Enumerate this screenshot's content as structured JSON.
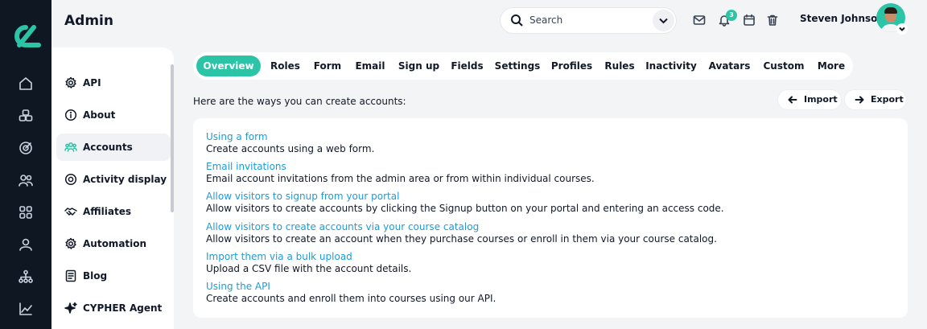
{
  "header": {
    "title": "Admin",
    "search_label": "Search",
    "notification_count": "3",
    "user_name": "Steven Johnson"
  },
  "colors": {
    "accent": "#2bc4a6",
    "link": "#1e9bd7",
    "rail": "#0f1722"
  },
  "rail_icons": [
    "home-icon",
    "modules-icon",
    "target-icon",
    "users-icon",
    "apps-grid-icon",
    "profile-icon",
    "org-chart-icon",
    "chart-icon"
  ],
  "sidebar": {
    "items": [
      {
        "label": "API",
        "icon": "gear-icon"
      },
      {
        "label": "About",
        "icon": "info-icon"
      },
      {
        "label": "Accounts",
        "icon": "people-icon"
      },
      {
        "label": "Activity display",
        "icon": "target-icon"
      },
      {
        "label": "Affiliates",
        "icon": "handshake-icon"
      },
      {
        "label": "Automation",
        "icon": "gear-icon"
      },
      {
        "label": "Blog",
        "icon": "document-icon"
      },
      {
        "label": "CYPHER Agent",
        "icon": "sparkle-icon"
      }
    ],
    "active": "Accounts"
  },
  "tabs": [
    {
      "label": "Overview"
    },
    {
      "label": "Roles"
    },
    {
      "label": "Form"
    },
    {
      "label": "Email"
    },
    {
      "label": "Sign up"
    },
    {
      "label": "Fields"
    },
    {
      "label": "Settings"
    },
    {
      "label": "Profiles"
    },
    {
      "label": "Rules"
    },
    {
      "label": "Inactivity"
    },
    {
      "label": "Avatars"
    },
    {
      "label": "Custom"
    },
    {
      "label": "More"
    }
  ],
  "main": {
    "intro": "Here are the ways you can create accounts:",
    "import_label": "Import",
    "export_label": "Export",
    "options": [
      {
        "title": "Using a form",
        "desc": "Create accounts using a web form."
      },
      {
        "title": "Email invitations",
        "desc": "Email account invitations from the admin area or from within individual courses."
      },
      {
        "title": "Allow visitors to signup from your portal",
        "desc": "Allow visitors to create accounts by clicking the Signup button on your portal and entering an access code."
      },
      {
        "title": "Allow visitors to create accounts via your course catalog",
        "desc": "Allow visitors to create an account when they purchase courses or enroll in them via your course catalog."
      },
      {
        "title": "Import them via a bulk upload",
        "desc": "Upload a CSV file with the account details."
      },
      {
        "title": "Using the API",
        "desc": "Create accounts and enroll them into courses using our API."
      }
    ]
  }
}
